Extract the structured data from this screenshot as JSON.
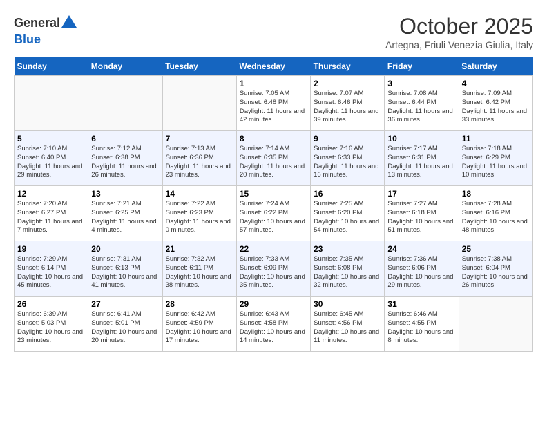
{
  "logo": {
    "general": "General",
    "blue": "Blue"
  },
  "title": "October 2025",
  "location": "Artegna, Friuli Venezia Giulia, Italy",
  "days_of_week": [
    "Sunday",
    "Monday",
    "Tuesday",
    "Wednesday",
    "Thursday",
    "Friday",
    "Saturday"
  ],
  "weeks": [
    [
      {
        "day": "",
        "info": ""
      },
      {
        "day": "",
        "info": ""
      },
      {
        "day": "",
        "info": ""
      },
      {
        "day": "1",
        "info": "Sunrise: 7:05 AM\nSunset: 6:48 PM\nDaylight: 11 hours and 42 minutes."
      },
      {
        "day": "2",
        "info": "Sunrise: 7:07 AM\nSunset: 6:46 PM\nDaylight: 11 hours and 39 minutes."
      },
      {
        "day": "3",
        "info": "Sunrise: 7:08 AM\nSunset: 6:44 PM\nDaylight: 11 hours and 36 minutes."
      },
      {
        "day": "4",
        "info": "Sunrise: 7:09 AM\nSunset: 6:42 PM\nDaylight: 11 hours and 33 minutes."
      }
    ],
    [
      {
        "day": "5",
        "info": "Sunrise: 7:10 AM\nSunset: 6:40 PM\nDaylight: 11 hours and 29 minutes."
      },
      {
        "day": "6",
        "info": "Sunrise: 7:12 AM\nSunset: 6:38 PM\nDaylight: 11 hours and 26 minutes."
      },
      {
        "day": "7",
        "info": "Sunrise: 7:13 AM\nSunset: 6:36 PM\nDaylight: 11 hours and 23 minutes."
      },
      {
        "day": "8",
        "info": "Sunrise: 7:14 AM\nSunset: 6:35 PM\nDaylight: 11 hours and 20 minutes."
      },
      {
        "day": "9",
        "info": "Sunrise: 7:16 AM\nSunset: 6:33 PM\nDaylight: 11 hours and 16 minutes."
      },
      {
        "day": "10",
        "info": "Sunrise: 7:17 AM\nSunset: 6:31 PM\nDaylight: 11 hours and 13 minutes."
      },
      {
        "day": "11",
        "info": "Sunrise: 7:18 AM\nSunset: 6:29 PM\nDaylight: 11 hours and 10 minutes."
      }
    ],
    [
      {
        "day": "12",
        "info": "Sunrise: 7:20 AM\nSunset: 6:27 PM\nDaylight: 11 hours and 7 minutes."
      },
      {
        "day": "13",
        "info": "Sunrise: 7:21 AM\nSunset: 6:25 PM\nDaylight: 11 hours and 4 minutes."
      },
      {
        "day": "14",
        "info": "Sunrise: 7:22 AM\nSunset: 6:23 PM\nDaylight: 11 hours and 0 minutes."
      },
      {
        "day": "15",
        "info": "Sunrise: 7:24 AM\nSunset: 6:22 PM\nDaylight: 10 hours and 57 minutes."
      },
      {
        "day": "16",
        "info": "Sunrise: 7:25 AM\nSunset: 6:20 PM\nDaylight: 10 hours and 54 minutes."
      },
      {
        "day": "17",
        "info": "Sunrise: 7:27 AM\nSunset: 6:18 PM\nDaylight: 10 hours and 51 minutes."
      },
      {
        "day": "18",
        "info": "Sunrise: 7:28 AM\nSunset: 6:16 PM\nDaylight: 10 hours and 48 minutes."
      }
    ],
    [
      {
        "day": "19",
        "info": "Sunrise: 7:29 AM\nSunset: 6:14 PM\nDaylight: 10 hours and 45 minutes."
      },
      {
        "day": "20",
        "info": "Sunrise: 7:31 AM\nSunset: 6:13 PM\nDaylight: 10 hours and 41 minutes."
      },
      {
        "day": "21",
        "info": "Sunrise: 7:32 AM\nSunset: 6:11 PM\nDaylight: 10 hours and 38 minutes."
      },
      {
        "day": "22",
        "info": "Sunrise: 7:33 AM\nSunset: 6:09 PM\nDaylight: 10 hours and 35 minutes."
      },
      {
        "day": "23",
        "info": "Sunrise: 7:35 AM\nSunset: 6:08 PM\nDaylight: 10 hours and 32 minutes."
      },
      {
        "day": "24",
        "info": "Sunrise: 7:36 AM\nSunset: 6:06 PM\nDaylight: 10 hours and 29 minutes."
      },
      {
        "day": "25",
        "info": "Sunrise: 7:38 AM\nSunset: 6:04 PM\nDaylight: 10 hours and 26 minutes."
      }
    ],
    [
      {
        "day": "26",
        "info": "Sunrise: 6:39 AM\nSunset: 5:03 PM\nDaylight: 10 hours and 23 minutes."
      },
      {
        "day": "27",
        "info": "Sunrise: 6:41 AM\nSunset: 5:01 PM\nDaylight: 10 hours and 20 minutes."
      },
      {
        "day": "28",
        "info": "Sunrise: 6:42 AM\nSunset: 4:59 PM\nDaylight: 10 hours and 17 minutes."
      },
      {
        "day": "29",
        "info": "Sunrise: 6:43 AM\nSunset: 4:58 PM\nDaylight: 10 hours and 14 minutes."
      },
      {
        "day": "30",
        "info": "Sunrise: 6:45 AM\nSunset: 4:56 PM\nDaylight: 10 hours and 11 minutes."
      },
      {
        "day": "31",
        "info": "Sunrise: 6:46 AM\nSunset: 4:55 PM\nDaylight: 10 hours and 8 minutes."
      },
      {
        "day": "",
        "info": ""
      }
    ]
  ]
}
